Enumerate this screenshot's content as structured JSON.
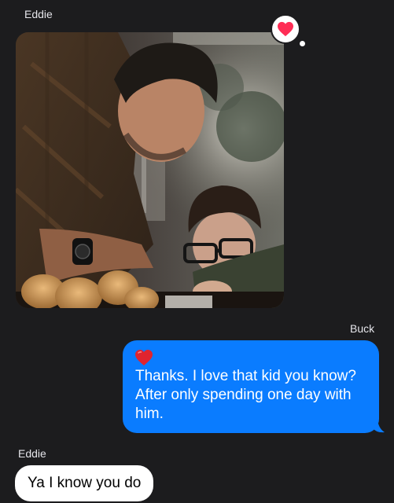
{
  "messages": [
    {
      "sender": "Eddie",
      "kind": "photo",
      "photo_subject": "man and boy at a table",
      "tapback": {
        "icon": "heart-icon",
        "color": "#ff2d55"
      }
    },
    {
      "sender": "Buck",
      "kind": "text",
      "outgoing": true,
      "emoji": "heart",
      "text": "Thanks. I love that kid you know? After only spending one day with him."
    },
    {
      "sender": "Eddie",
      "kind": "text",
      "outgoing": false,
      "text": "Ya I know you do"
    }
  ],
  "colors": {
    "background": "#1c1c1e",
    "outgoing_bubble": "#0a7cff",
    "incoming_bubble": "#ffffff",
    "tapback_heart": "#ff2d55",
    "emoji_heart": "#e0242f"
  }
}
